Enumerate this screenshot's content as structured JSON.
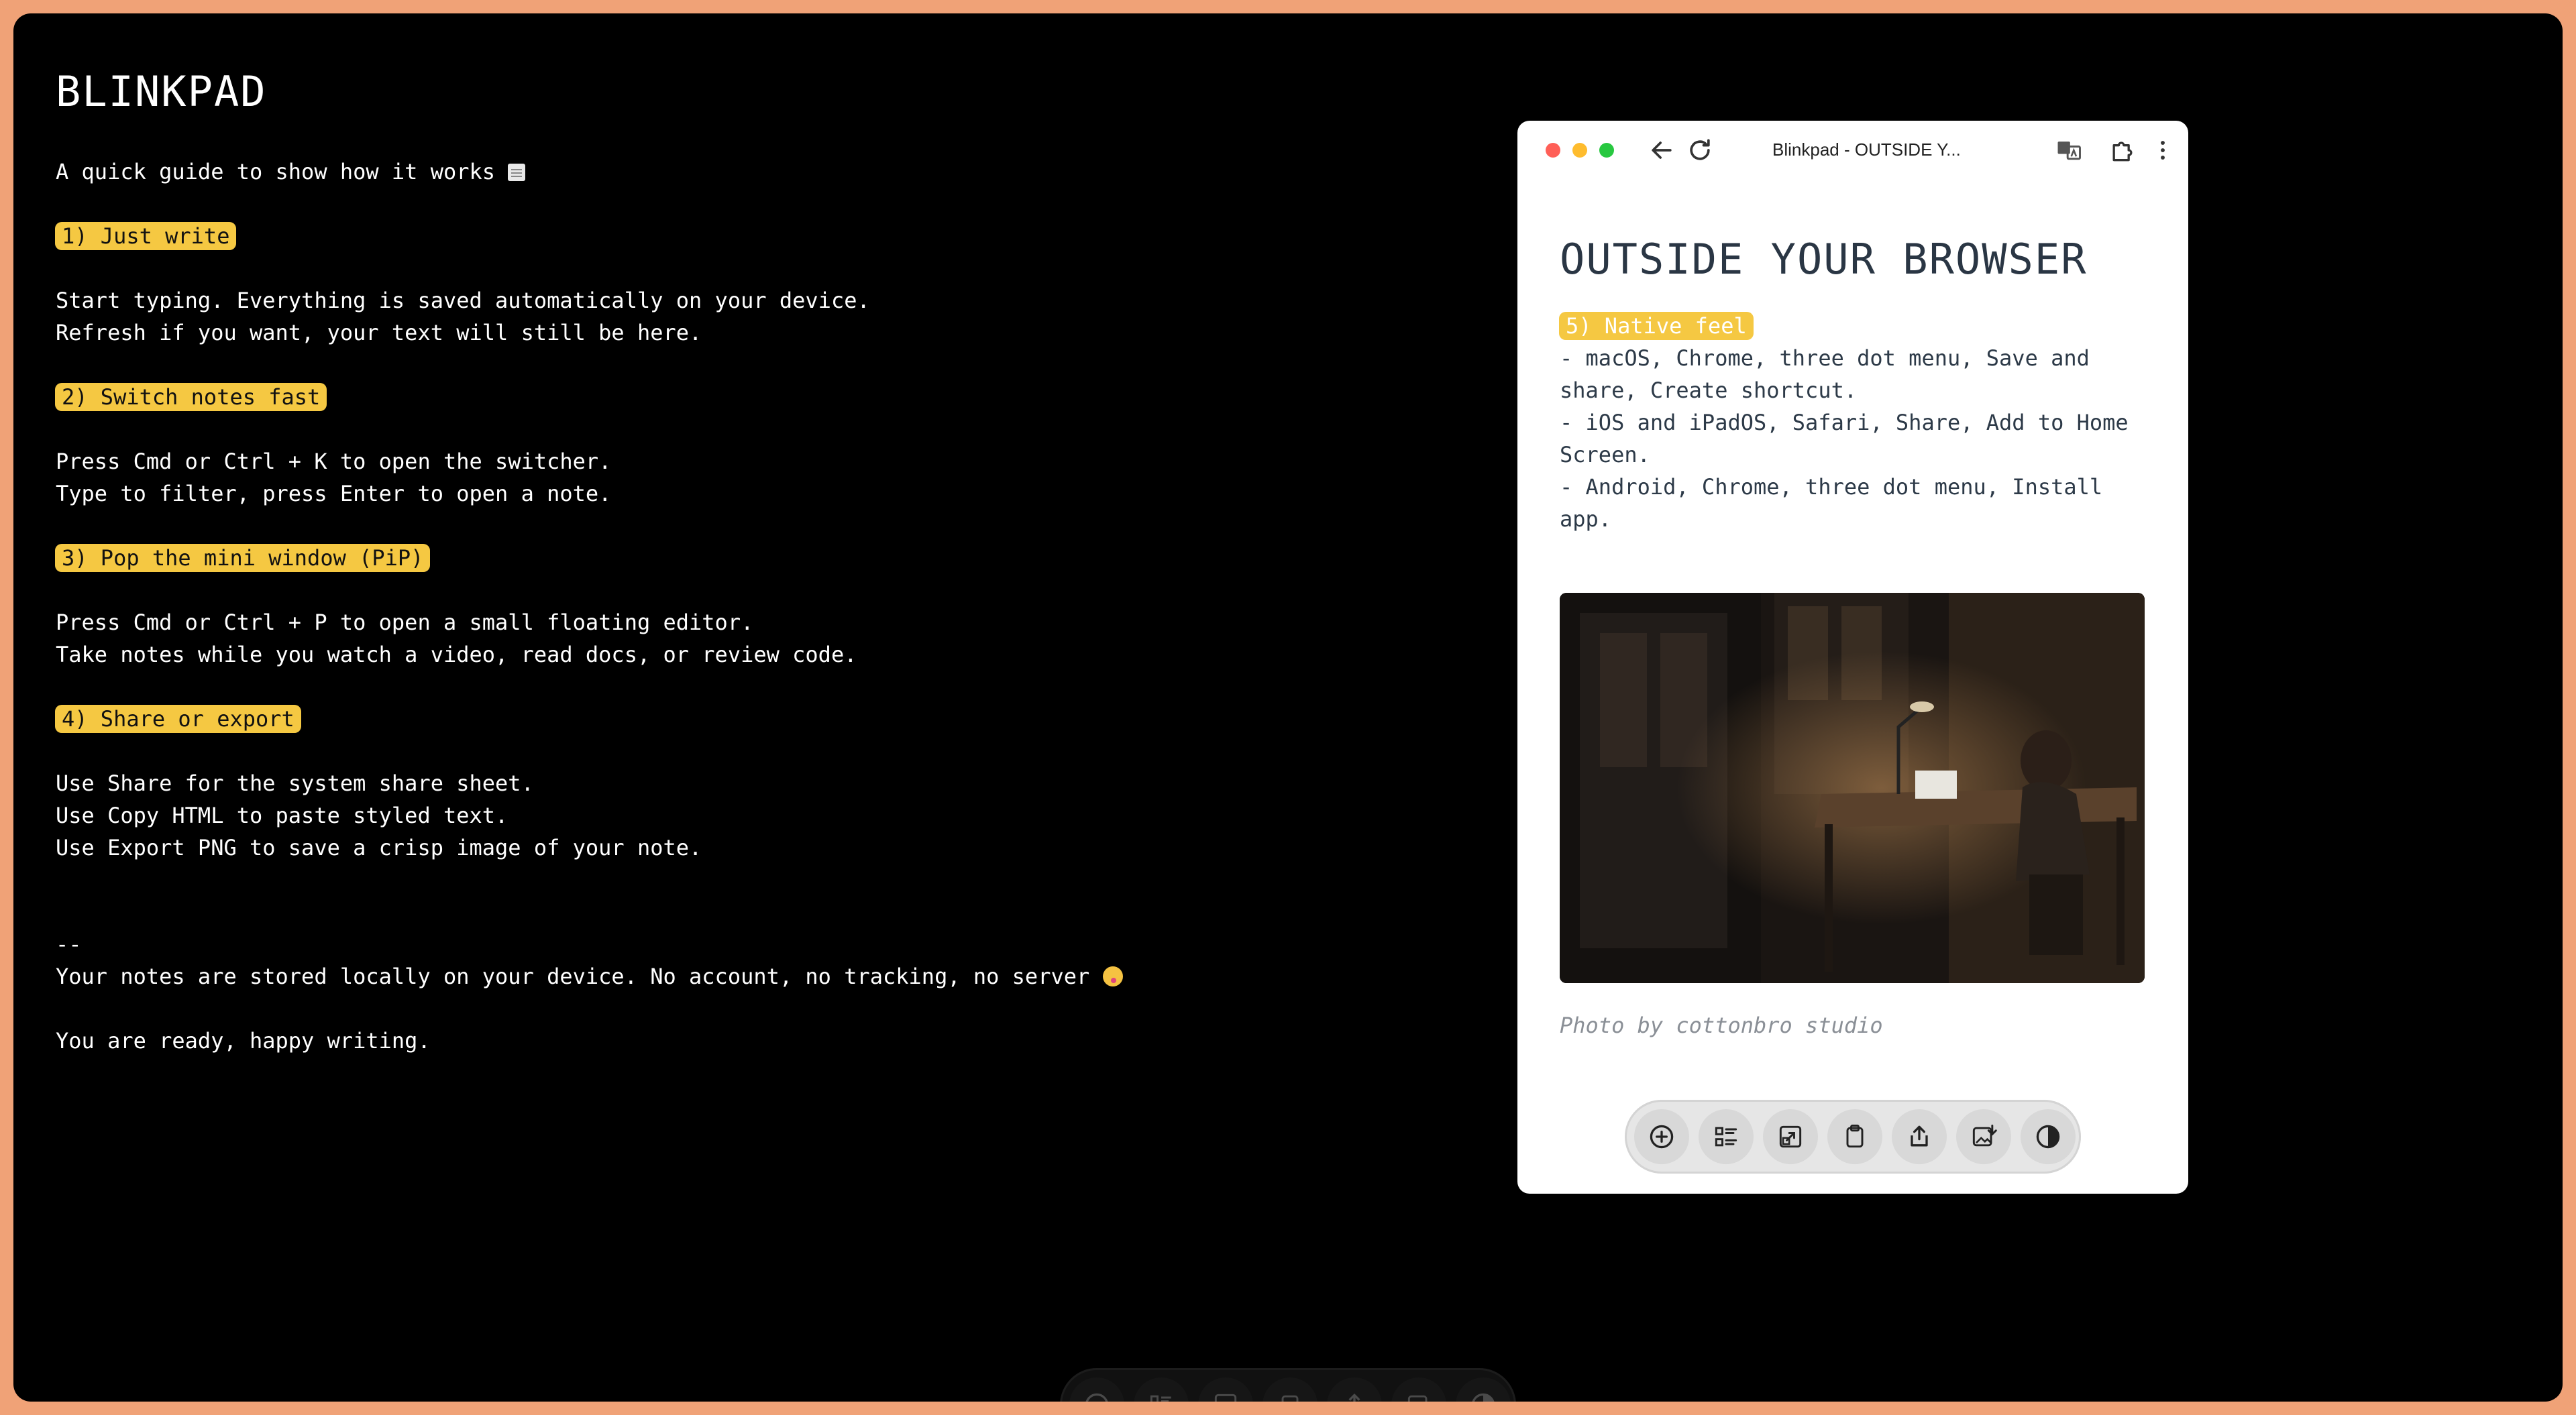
{
  "editor": {
    "title": "BLINKPAD",
    "intro": "A quick guide to show how it works",
    "section1": {
      "heading": "1) Just write",
      "lines": [
        "Start typing. Everything is saved automatically on your device.",
        "Refresh if you want, your text will still be here."
      ]
    },
    "section2": {
      "heading": "2) Switch notes fast",
      "lines": [
        "Press Cmd or Ctrl + K to open the switcher.",
        "Type to filter, press Enter to open a note."
      ]
    },
    "section3": {
      "heading": "3) Pop the mini window (PiP)",
      "lines": [
        "Press Cmd or Ctrl + P to open a small floating editor.",
        "Take notes while you watch a video, read docs, or review code."
      ]
    },
    "section4": {
      "heading": "4) Share or export",
      "lines": [
        "Use Share for the system share sheet.",
        "Use Copy HTML to paste styled text.",
        "Use Export PNG to save a crisp image of your note."
      ]
    },
    "separator": "--",
    "privacy": "Your notes are stored locally on your device. No account, no tracking, no server",
    "closing": "You are ready, happy writing."
  },
  "pip": {
    "window_title": "Blinkpad - OUTSIDE Y...",
    "heading": "OUTSIDE YOUR BROWSER",
    "section5": {
      "heading": "5) Native feel",
      "lines": [
        "- macOS, Chrome, three dot menu, Save and",
        "share, Create shortcut.",
        "- iOS and iPadOS, Safari, Share, Add to Home",
        "Screen.",
        "- Android, Chrome, three dot menu, Install",
        "app."
      ]
    },
    "photo_caption": "Photo by cottonbro studio"
  },
  "toolbar": {
    "buttons": [
      "new-note",
      "switcher",
      "pip",
      "copy-html",
      "share",
      "export-png",
      "theme-toggle"
    ]
  },
  "colors": {
    "highlight": "#f5c842",
    "background": "#000000",
    "frame": "#f0a277"
  }
}
